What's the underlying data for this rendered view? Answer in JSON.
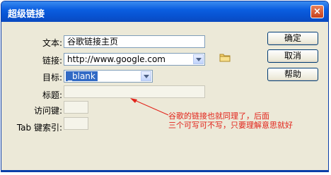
{
  "window": {
    "title": "超级链接",
    "close_label": "×"
  },
  "form": {
    "text_label": "文本:",
    "text_value": "谷歌链接主页",
    "link_label": "链接:",
    "link_value": "http://www.google.com",
    "target_label": "目标:",
    "target_value": "_blank",
    "title_label": "标题:",
    "title_value": "",
    "accesskey_label": "访问键:",
    "accesskey_value": "",
    "tabindex_label": "Tab 键索引:",
    "tabindex_value": ""
  },
  "buttons": {
    "ok": "确定",
    "cancel": "取消",
    "help": "帮助"
  },
  "annotation": {
    "line1": "谷歌的链接也就同理了，后面",
    "line2": "三个可写可不写，只要理解意思就好",
    "color": "#e2231a"
  },
  "icons": {
    "folder": "folder-icon",
    "close": "close-icon",
    "dropdown": "chevron-down-icon"
  }
}
